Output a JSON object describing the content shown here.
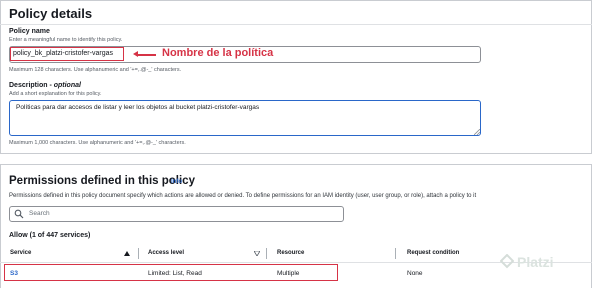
{
  "policy_details": {
    "title": "Policy details",
    "name_label": "Policy name",
    "name_hint": "Enter a meaningful name to identify this policy.",
    "name_value": "policy_bk_platzi-cristofer-vargas",
    "name_constraint": "Maximum 128 characters. Use alphanumeric and '+=,.@-_' characters.",
    "annotation": "Nombre de la política",
    "desc_label": "Description - ",
    "desc_label_optional": "optional",
    "desc_hint": "Add a short explanation for this policy.",
    "desc_value": "Políticas para dar accesos de listar y leer los objetos al bucket platzi-cristofer-vargas",
    "desc_constraint": "Maximum 1,000 characters. Use alphanumeric and '+=,.@-_' characters."
  },
  "permissions": {
    "title": "Permissions defined in this policy",
    "info_link": "Info",
    "description": "Permissions defined in this policy document specify which actions are allowed or denied. To define permissions for an IAM identity (user, user group, or role), attach a policy to it",
    "search_placeholder": "Search",
    "allow_heading": "Allow (1 of 447 services)",
    "columns": [
      "Service",
      "Access level",
      "Resource",
      "Request condition"
    ],
    "rows": [
      {
        "service": "S3",
        "access_level": "Limited: List, Read",
        "resource": "Multiple",
        "request_condition": "None"
      }
    ]
  },
  "watermark": "Platzi",
  "icons": {
    "search": "search-icon",
    "sort_asc": "caret-up-icon",
    "sort_desc": "caret-down-icon",
    "resize": "textarea-resize-icon",
    "watermark": "platzi-logo-icon"
  },
  "colors": {
    "accent_blue": "#2a67c9",
    "annotation_red": "#d63346"
  }
}
